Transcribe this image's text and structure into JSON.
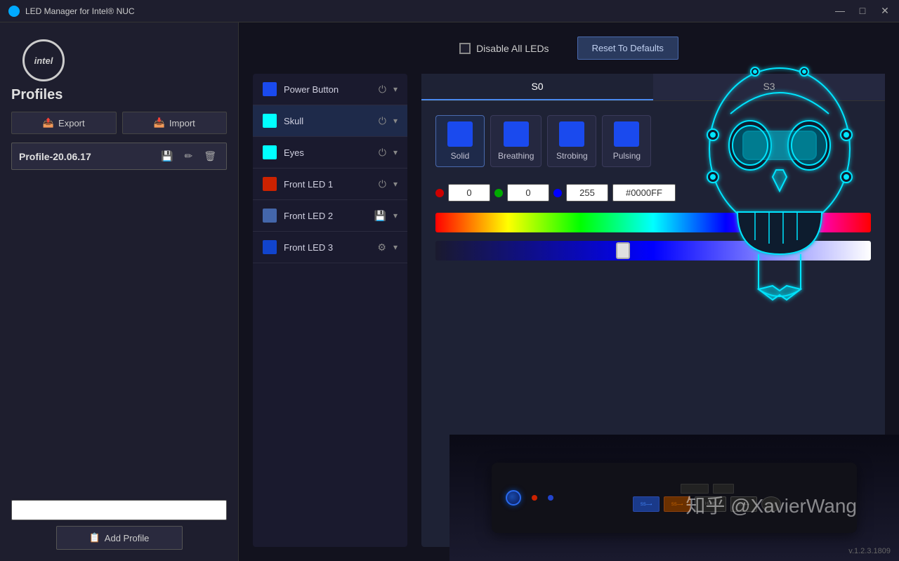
{
  "titleBar": {
    "icon": "●",
    "title": "LED Manager for Intel® NUC",
    "minimize": "—",
    "maximize": "□",
    "close": "✕"
  },
  "header": {
    "disableLabel": "Disable All LEDs",
    "resetLabel": "Reset To Defaults"
  },
  "sidebar": {
    "profilesTitle": "Profiles",
    "exportLabel": "Export",
    "importLabel": "Import",
    "profileName": "Profile-20.06.17",
    "profileInputPlaceholder": "",
    "addProfileLabel": "Add Profile"
  },
  "ledItems": [
    {
      "name": "Power Button",
      "color": "#1a4aee",
      "icon": "⏻"
    },
    {
      "name": "Skull",
      "color": "#00ffff",
      "icon": "⏻"
    },
    {
      "name": "Eyes",
      "color": "#00ffff",
      "icon": "⏻"
    },
    {
      "name": "Front LED 1",
      "color": "#cc2200",
      "icon": "⏻"
    },
    {
      "name": "Front LED 2",
      "color": "#4466aa",
      "icon": "💾"
    },
    {
      "name": "Front LED 3",
      "color": "#1144cc",
      "icon": "⚙"
    }
  ],
  "stateTabs": [
    {
      "label": "S0",
      "active": true
    },
    {
      "label": "S3",
      "active": false
    }
  ],
  "effects": [
    {
      "label": "Solid",
      "color": "#1a4aee",
      "active": true
    },
    {
      "label": "Breathing",
      "color": "#1a4aee",
      "active": false
    },
    {
      "label": "Strobing",
      "color": "#1a4aee",
      "active": false
    },
    {
      "label": "Pulsing",
      "color": "#1a4aee",
      "active": false
    }
  ],
  "colorInputs": {
    "rDot": "#cc0000",
    "gDot": "#00aa00",
    "bDot": "#0000ff",
    "rValue": "0",
    "gValue": "0",
    "bValue": "255",
    "hexValue": "#0000FF"
  },
  "version": "v.1.2.3.1809",
  "watermark": "知乎 @XavierWang"
}
